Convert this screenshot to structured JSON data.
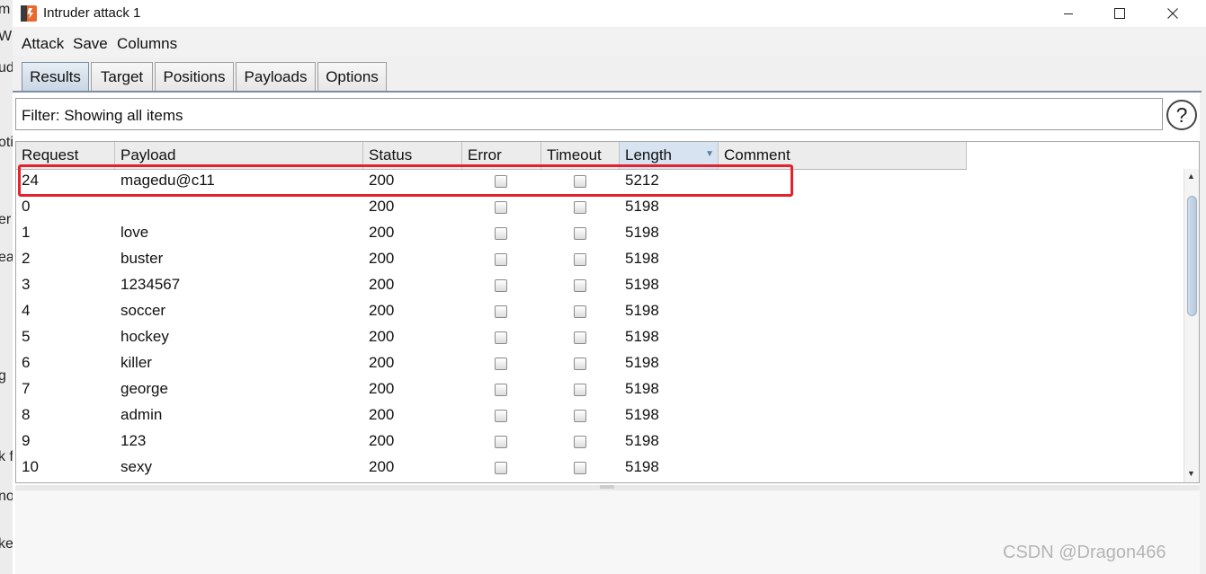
{
  "background": {
    "fragments": [
      "m",
      "Wi",
      "ud",
      "oti",
      "er",
      "ea",
      "g",
      "k fi",
      "no",
      "ke"
    ]
  },
  "window": {
    "title": "Intruder attack 1",
    "controls": [
      "minimize-icon",
      "maximize-icon",
      "close-icon"
    ]
  },
  "menu": {
    "items": [
      "Attack",
      "Save",
      "Columns"
    ]
  },
  "tabs": {
    "items": [
      "Results",
      "Target",
      "Positions",
      "Payloads",
      "Options"
    ],
    "active": "Results"
  },
  "filter": {
    "text": "Filter: Showing all items",
    "help_label": "?"
  },
  "results_table": {
    "columns": [
      "Request",
      "Payload",
      "Status",
      "Error",
      "Timeout",
      "Length",
      "Comment"
    ],
    "sorted_column": "Length",
    "rows": [
      {
        "request": "24",
        "payload": "magedu@c11",
        "status": "200",
        "error": false,
        "timeout": false,
        "length": "5212",
        "comment": "",
        "highlighted": true
      },
      {
        "request": "0",
        "payload": "",
        "status": "200",
        "error": false,
        "timeout": false,
        "length": "5198",
        "comment": ""
      },
      {
        "request": "1",
        "payload": "love",
        "status": "200",
        "error": false,
        "timeout": false,
        "length": "5198",
        "comment": ""
      },
      {
        "request": "2",
        "payload": "buster",
        "status": "200",
        "error": false,
        "timeout": false,
        "length": "5198",
        "comment": ""
      },
      {
        "request": "3",
        "payload": "1234567",
        "status": "200",
        "error": false,
        "timeout": false,
        "length": "5198",
        "comment": ""
      },
      {
        "request": "4",
        "payload": "soccer",
        "status": "200",
        "error": false,
        "timeout": false,
        "length": "5198",
        "comment": ""
      },
      {
        "request": "5",
        "payload": "hockey",
        "status": "200",
        "error": false,
        "timeout": false,
        "length": "5198",
        "comment": ""
      },
      {
        "request": "6",
        "payload": "killer",
        "status": "200",
        "error": false,
        "timeout": false,
        "length": "5198",
        "comment": ""
      },
      {
        "request": "7",
        "payload": "george",
        "status": "200",
        "error": false,
        "timeout": false,
        "length": "5198",
        "comment": ""
      },
      {
        "request": "8",
        "payload": "admin",
        "status": "200",
        "error": false,
        "timeout": false,
        "length": "5198",
        "comment": ""
      },
      {
        "request": "9",
        "payload": "123",
        "status": "200",
        "error": false,
        "timeout": false,
        "length": "5198",
        "comment": ""
      },
      {
        "request": "10",
        "payload": "sexy",
        "status": "200",
        "error": false,
        "timeout": false,
        "length": "5198",
        "comment": ""
      }
    ]
  },
  "highlight_color": "#e5212b",
  "watermark": "CSDN @Dragon466"
}
